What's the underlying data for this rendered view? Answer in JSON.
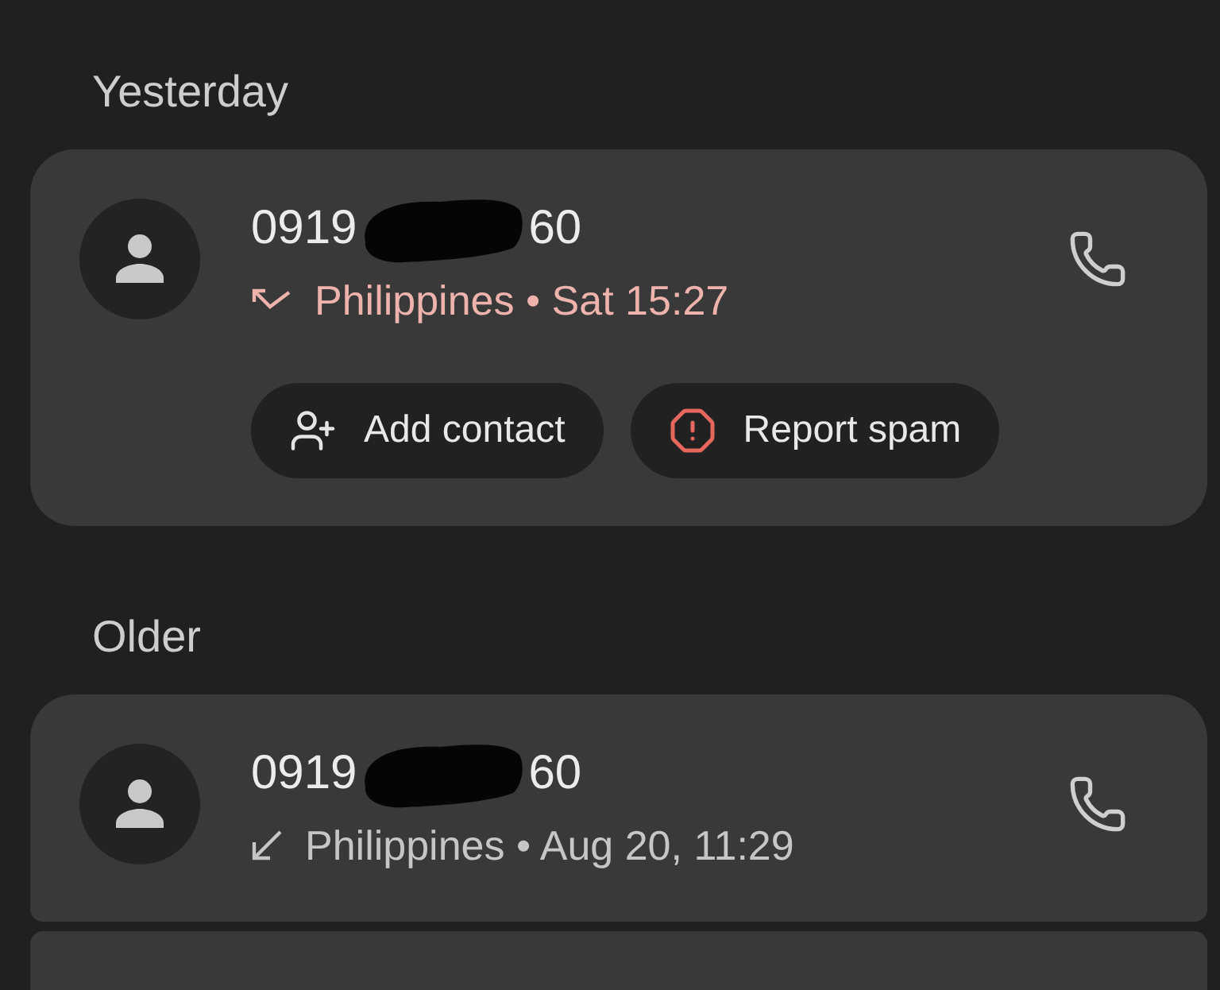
{
  "sections": [
    {
      "title": "Yesterday",
      "calls": [
        {
          "number_start": "0919",
          "number_end": "60",
          "redacted": true,
          "kind": "missed",
          "detail": "Philippines • Sat 15:27",
          "actions": [
            {
              "kind": "add_contact",
              "label": "Add contact"
            },
            {
              "kind": "report_spam",
              "label": "Report spam"
            }
          ]
        }
      ]
    },
    {
      "title": "Older",
      "more_below": true,
      "calls": [
        {
          "number_start": "0919",
          "number_end": "60",
          "redacted": true,
          "kind": "incoming",
          "detail": "Philippines • Aug 20, 11:29"
        }
      ]
    }
  ]
}
